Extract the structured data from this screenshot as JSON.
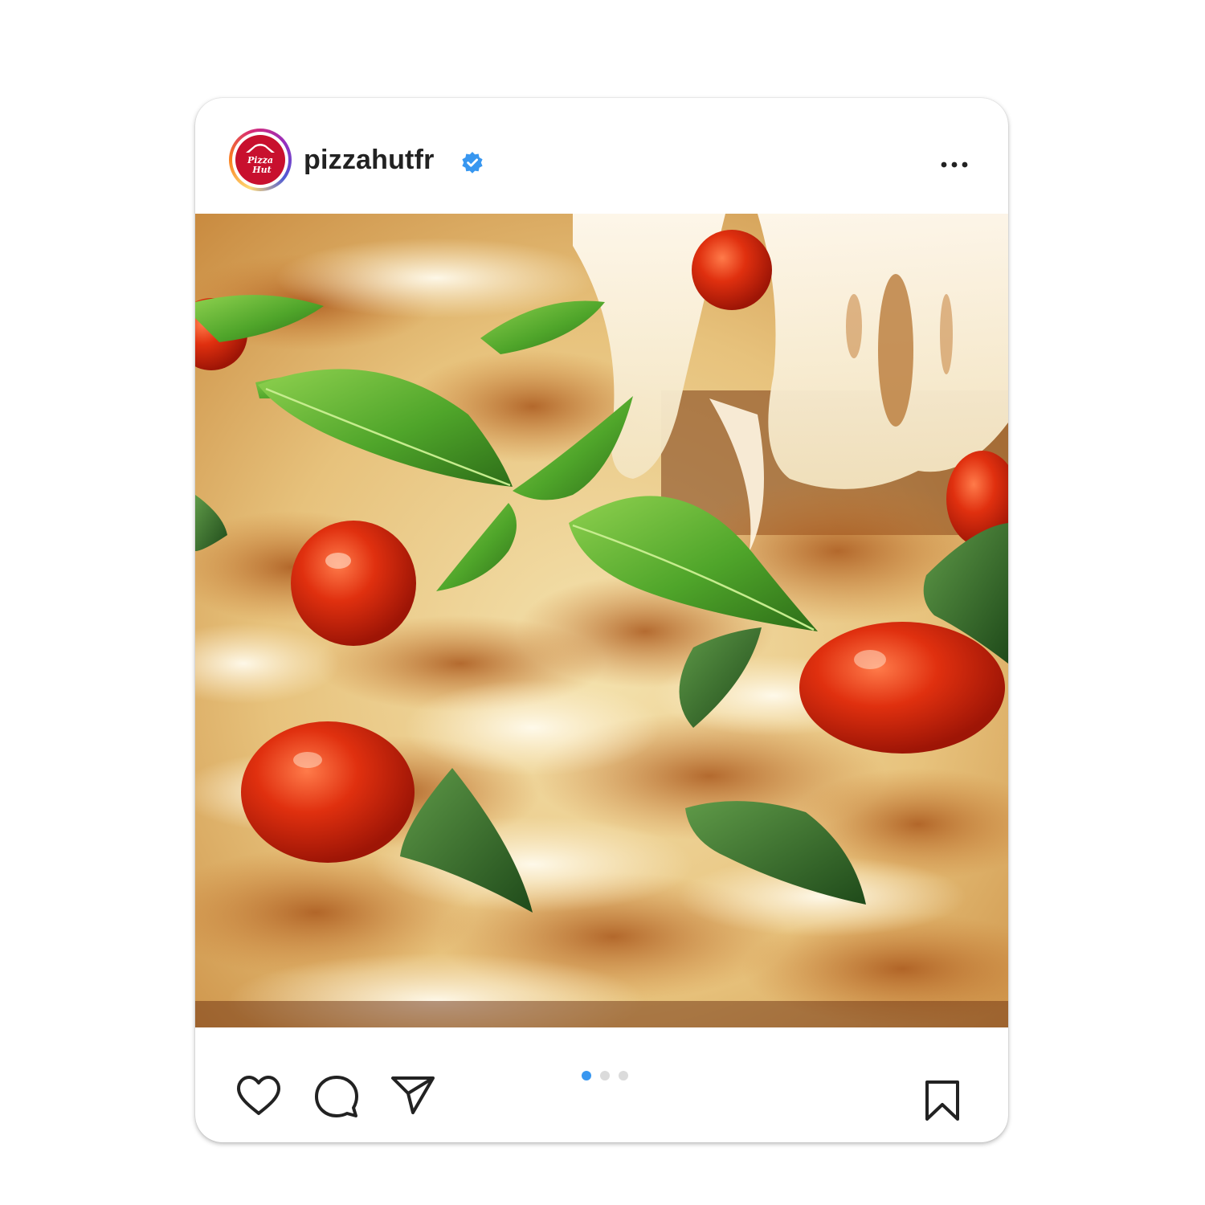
{
  "post": {
    "username": "pizzahutfr",
    "verified": true,
    "avatar_logo_text": "Pizza Hut",
    "image_subject": "margherita-pizza-photo",
    "carousel": {
      "total_slides": 3,
      "active_index": 0
    },
    "actions": {
      "like_icon": "heart-icon",
      "comment_icon": "comment-bubble-icon",
      "share_icon": "paper-plane-icon",
      "save_icon": "bookmark-icon",
      "more_icon": "ellipsis-icon"
    }
  },
  "colors": {
    "brand_red": "#c8102e",
    "verified_blue": "#3897f0",
    "active_dot": "#3897f0",
    "inactive_dot": "#dbdbdb",
    "icon_stroke": "#222222"
  }
}
